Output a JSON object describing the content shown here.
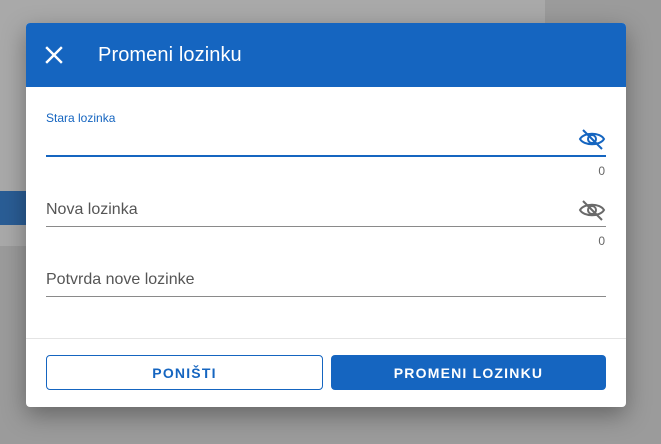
{
  "dialog": {
    "title": "Promeni lozinku",
    "close_icon": "close-icon",
    "fields": [
      {
        "label": "Stara lozinka",
        "counter": "0",
        "icon": "eye-slash-icon",
        "state": "focused"
      },
      {
        "label": "Nova lozinka",
        "counter": "0",
        "icon": "eye-slash-icon",
        "state": "default"
      },
      {
        "label": "Potvrda nove lozinke",
        "state": "default"
      }
    ],
    "buttons": {
      "cancel": "PONIŠTI",
      "submit": "PROMENI LOZINKU"
    }
  },
  "colors": {
    "primary": "#1565c0",
    "overlay": "#9b9b9b",
    "text_muted": "#555555"
  }
}
